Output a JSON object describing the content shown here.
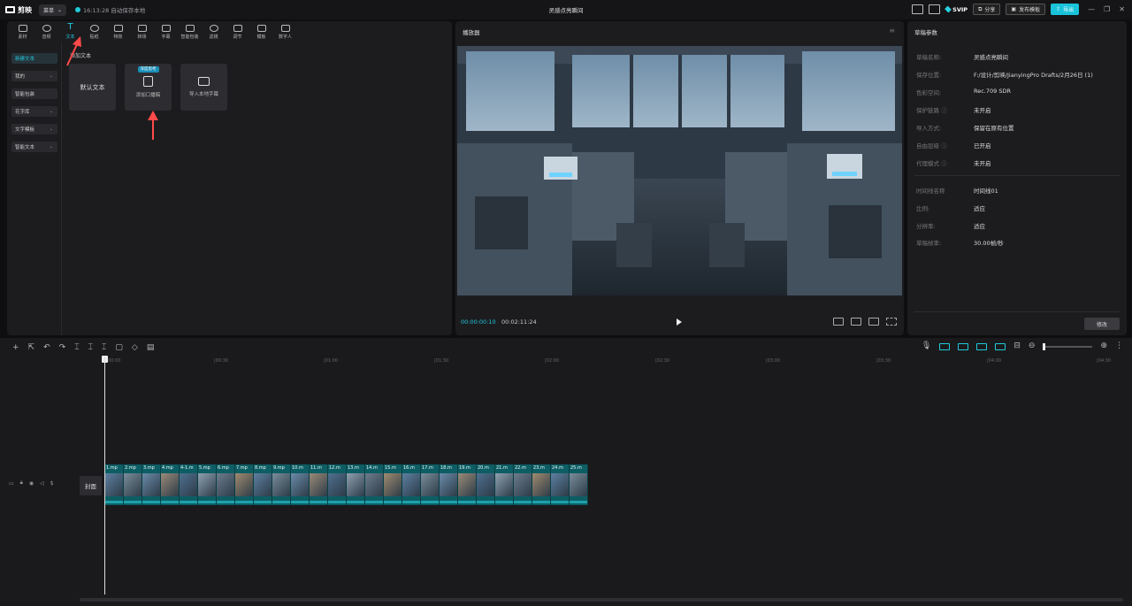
{
  "titlebar": {
    "app_name": "剪映",
    "menu_label": "菜单",
    "autosave": "16:13:28 自动保存本地",
    "project_title": "灵感点亮瞬间",
    "svip": "SVIP",
    "share": "分享",
    "publish_template": "发布模板",
    "export": "导出"
  },
  "media_tabs": [
    {
      "label": "素材"
    },
    {
      "label": "音频"
    },
    {
      "label": "文本"
    },
    {
      "label": "贴纸"
    },
    {
      "label": "特效"
    },
    {
      "label": "转场"
    },
    {
      "label": "字幕"
    },
    {
      "label": "智能包装"
    },
    {
      "label": "滤镜"
    },
    {
      "label": "调节"
    },
    {
      "label": "模板"
    },
    {
      "label": "数字人"
    }
  ],
  "text_sidebar": [
    {
      "label": "新建文本"
    },
    {
      "label": "我的"
    },
    {
      "label": "智能包装"
    },
    {
      "label": "花字库"
    },
    {
      "label": "文字模板"
    },
    {
      "label": "智能文本"
    }
  ],
  "text_panel": {
    "section_title": "添加文本",
    "default_text": "默认文本",
    "add_lyrics": "添加口播稿",
    "smart_badge": "深度思考",
    "import_local": "导入本地字幕"
  },
  "player": {
    "title": "播放器",
    "current_time": "00:00:00:10",
    "total_time": "00:02:11:24"
  },
  "draft": {
    "title": "草稿参数",
    "props_group1": [
      {
        "label": "草稿名称:",
        "value": "灵感点亮瞬间"
      },
      {
        "label": "保存位置:",
        "value": "F:/设计/剪映/JianyingPro Drafts/2月26日 (1)"
      },
      {
        "label": "色彩空间:",
        "value": "Rec.709 SDR"
      },
      {
        "label": "保护链路 ⓘ",
        "value": "未开启"
      },
      {
        "label": "导入方式:",
        "value": "保留在原有位置"
      },
      {
        "label": "自由层级 ⓘ",
        "value": "已开启"
      },
      {
        "label": "代理模式 ⓘ",
        "value": "未开启"
      }
    ],
    "props_group2": [
      {
        "label": "时间线名称",
        "value": "时间线01"
      },
      {
        "label": "比例:",
        "value": "适应"
      },
      {
        "label": "分辨率:",
        "value": "适应"
      },
      {
        "label": "草稿帧率:",
        "value": "30.00帧/秒"
      }
    ],
    "modify": "修改"
  },
  "timeline": {
    "ruler": [
      "00:00",
      "|00:30",
      "|01:00",
      "|01:30",
      "|02:00",
      "|02:30",
      "|03:00",
      "|03:30",
      "|04:00",
      "|04:30"
    ],
    "cover": "封面",
    "clips": [
      "1.mp",
      "2.mp",
      "3.mp",
      "4.mp",
      "4-1.m",
      "5.mp",
      "6.mp",
      "7.mp",
      "8.mp",
      "9.mp",
      "10.m",
      "11.m",
      "12.m",
      "13.m",
      "14.m",
      "15.m",
      "16.m",
      "17.m",
      "18.m",
      "19.m",
      "20.m",
      "21.m",
      "22.m",
      "23.m",
      "24.m",
      "25.m"
    ]
  },
  "colors": {
    "accent": "#20c9dc",
    "clip": "#0d5e64",
    "panel": "#1c1c1f"
  }
}
